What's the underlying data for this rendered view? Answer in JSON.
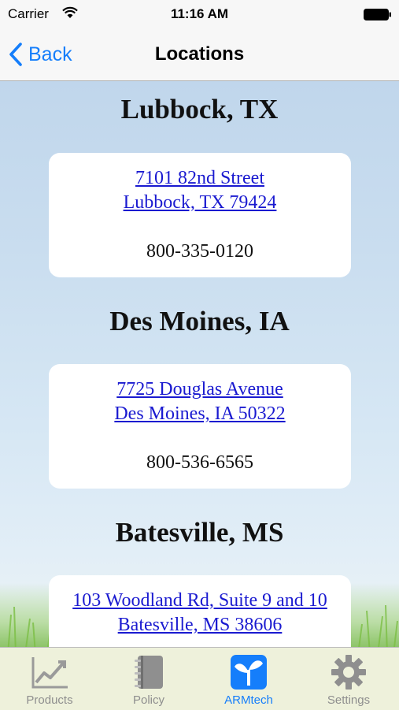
{
  "status_bar": {
    "carrier": "Carrier",
    "time": "11:16 AM"
  },
  "nav": {
    "back_label": "Back",
    "title": "Locations"
  },
  "locations": [
    {
      "name": "Lubbock, TX",
      "address_line1": "7101 82nd Street",
      "address_line2": "Lubbock, TX 79424",
      "phone": "800-335-0120"
    },
    {
      "name": "Des Moines, IA",
      "address_line1": "7725 Douglas Avenue",
      "address_line2": "Des Moines, IA 50322",
      "phone": "800-536-6565"
    },
    {
      "name": "Batesville, MS",
      "address_line1": "103 Woodland Rd, Suite 9 and 10",
      "address_line2": "Batesville, MS 38606"
    }
  ],
  "tabs": [
    {
      "label": "Products",
      "icon": "chart-icon"
    },
    {
      "label": "Policy",
      "icon": "notebook-icon"
    },
    {
      "label": "ARMtech",
      "icon": "armtech-logo-icon",
      "active": true
    },
    {
      "label": "Settings",
      "icon": "gear-icon"
    }
  ],
  "colors": {
    "accent": "#157efb",
    "link": "#1a1ad0",
    "tab_inactive": "#8e8e8e"
  }
}
